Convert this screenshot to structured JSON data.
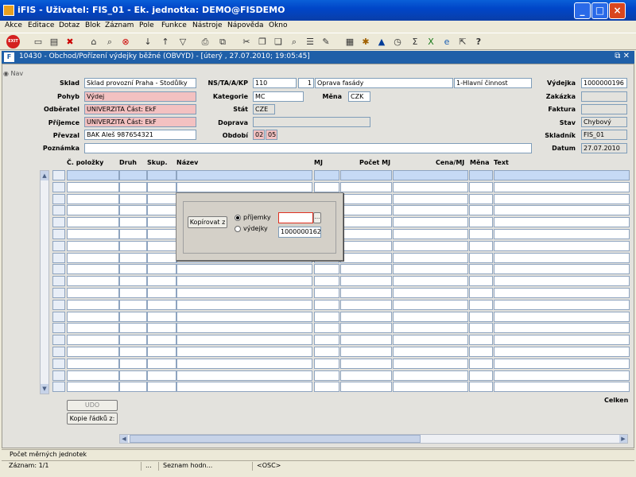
{
  "window": {
    "title": "iFIS - Uživatel: FIS_01 - Ek. jednotka: DEMO@FISDEMO"
  },
  "menu": [
    "Akce",
    "Editace",
    "Dotaz",
    "Blok",
    "Záznam",
    "Pole",
    "Funkce",
    "Nástroje",
    "Nápověda",
    "Okno"
  ],
  "toolbar": {
    "exit_label": "EXIT"
  },
  "form": {
    "title": "10430 - Obchod/Pořízení výdejky běžné (OBVYD) - [úterý , 27.07.2010; 19:05:45]",
    "nav_label": "Nav",
    "labels": {
      "sklad": "Sklad",
      "pohyb": "Pohyb",
      "odberatel": "Odběratel",
      "prijemce": "Příjemce",
      "prevzal": "Převzal",
      "poznamka": "Poznámka",
      "ns": "NS/TA/A/KP",
      "kategorie": "Kategorie",
      "mena": "Měna",
      "stat": "Stát",
      "doprava": "Doprava",
      "obdobi": "Období",
      "vydejka": "Výdejka",
      "zakazka": "Zakázka",
      "faktura": "Faktura",
      "stav": "Stav",
      "skladnik": "Skladník",
      "datum": "Datum"
    },
    "values": {
      "sklad": "Sklad provozní Praha - Stodůlky",
      "pohyb": "Výdej",
      "odberatel": "UNIVERZITA Část: EkF",
      "prijemce": "UNIVERZITA Část: EkF",
      "prevzal": "BAK Aleš 987654321",
      "poznamka": "",
      "ns": "110",
      "ta": "1",
      "a_name": "Oprava fasády",
      "kp": "1-Hlavní činnost",
      "kategorie": "MC",
      "mena": "CZK",
      "stat": "CZE",
      "doprava": "",
      "obdobi_m": "02",
      "obdobi_y": "05",
      "vydejka": "1000000196",
      "zakazka": "",
      "faktura": "",
      "stav": "Chybový",
      "skladnik": "FIS_01",
      "datum": "27.07.2010"
    }
  },
  "grid": {
    "columns": [
      "Č. položky",
      "Druh",
      "Skup.",
      "Název",
      "MJ",
      "Počet MJ",
      "Cena/MJ",
      "Měna",
      "Text"
    ],
    "rows": 19,
    "right_label": "Celken"
  },
  "dialog": {
    "copy_button": "Kopírovat z",
    "option1": "příjemky",
    "option2": "výdejky",
    "selected": "příjemky",
    "input1": "",
    "input2": "1000000162",
    "lov_button": "..."
  },
  "bottom": {
    "udo_button": "UDO",
    "copy_rows_button": "Kopie řádků z:"
  },
  "status": {
    "message": "Počet měrných jednotek",
    "record": "Záznam: 1/1",
    "dots": "...",
    "list": "Seznam hodn...",
    "osc": "<OSC>"
  }
}
